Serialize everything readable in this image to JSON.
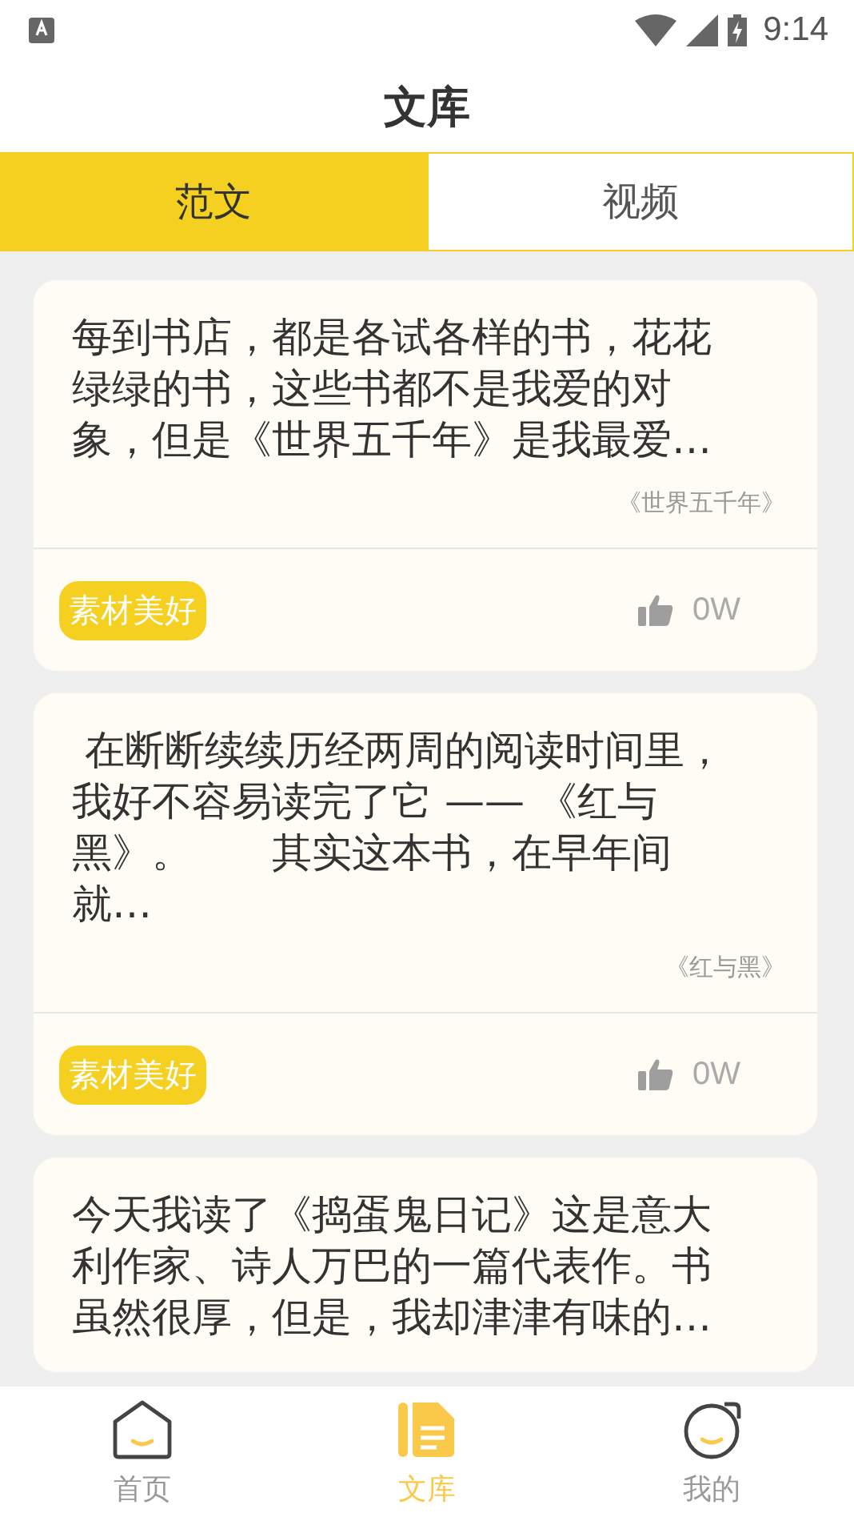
{
  "status_bar": {
    "time": "9:14"
  },
  "header": {
    "title": "文库"
  },
  "tabs": [
    {
      "label": "范文",
      "selected": true
    },
    {
      "label": "视频",
      "selected": false
    }
  ],
  "articles": [
    {
      "excerpt": "每到书店，都是各试各样的书，花花绿绿的书，这些书都不是我爱的对象，但是《世界五千年》是我最爱…",
      "source": "《世界五千年》",
      "tag": "素材美好",
      "likes": "0W"
    },
    {
      "excerpt": " 在断断续续历经两周的阅读时间里，我好不容易读完了它 —— 《红与黑》。　　其实这本书，在早年间就…",
      "source": "《红与黑》",
      "tag": "素材美好",
      "likes": "0W"
    },
    {
      "excerpt": "今天我读了《捣蛋鬼日记》这是意大利作家、诗人万巴的一篇代表作。书虽然很厚，但是，我却津津有味的…"
    }
  ],
  "bottom_nav": [
    {
      "label": "首页",
      "kind": "home",
      "selected": false
    },
    {
      "label": "文库",
      "kind": "library",
      "selected": true
    },
    {
      "label": "我的",
      "kind": "profile",
      "selected": false
    }
  ]
}
